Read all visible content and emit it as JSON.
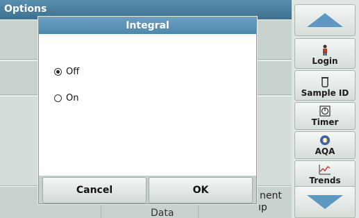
{
  "window": {
    "title": "Options"
  },
  "dialog": {
    "title": "Integral",
    "options": [
      {
        "label": "Off",
        "selected": true
      },
      {
        "label": "On",
        "selected": false
      }
    ],
    "cancel_label": "Cancel",
    "ok_label": "OK"
  },
  "sidebar": {
    "login_label": "Login",
    "sample_id_label": "Sample ID",
    "timer_label": "Timer",
    "aqa_label": "AQA",
    "trends_label": "Trends"
  },
  "background": {
    "bottom_fragment_1": "nent",
    "bottom_fragment_2": "ıp",
    "bottom_fragment_3": "Data"
  },
  "colors": {
    "title_bar": "#4a7e9f",
    "accent": "#5b95bb",
    "arrow": "#5e97c2"
  }
}
